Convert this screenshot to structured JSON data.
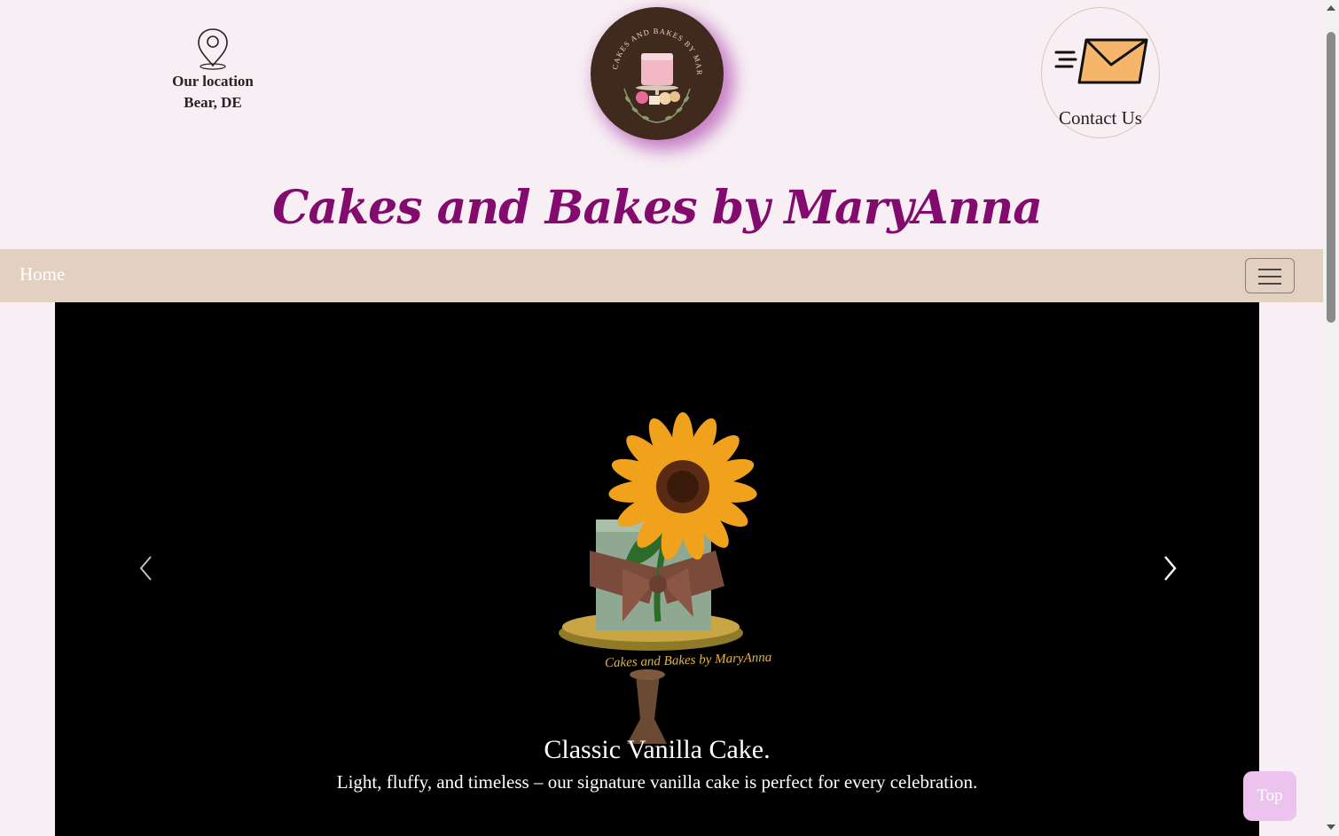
{
  "header": {
    "location": {
      "label": "Our location",
      "city": "Bear, DE",
      "icon": "location-pin-icon"
    },
    "logo": {
      "ring_text": "CAKES AND BAKES BY MARYANNA",
      "bg_color": "#3f2a1d"
    },
    "contact": {
      "label": "Contact Us",
      "icon": "envelope-icon"
    },
    "title": "Cakes and Bakes by MaryAnna",
    "title_color": "#820b6d"
  },
  "navbar": {
    "home_label": "Home",
    "toggler_icon": "hamburger-menu-icon",
    "bg_color": "#e2d0c1"
  },
  "carousel": {
    "slide": {
      "title": "Classic Vanilla Cake.",
      "text": "Light, fluffy, and timeless – our signature vanilla cake is perfect for every celebration.",
      "watermark": "Cakes and Bakes by MaryAnna"
    },
    "prev_icon": "chevron-left-icon",
    "next_icon": "chevron-right-icon"
  },
  "top_button": {
    "label": "Top",
    "color": "#ecc3ee"
  }
}
